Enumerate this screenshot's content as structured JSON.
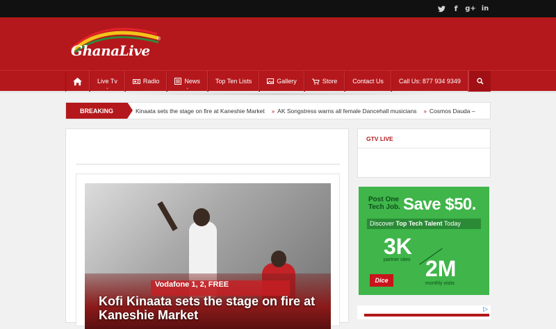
{
  "topbar": {
    "social": [
      {
        "icon": "twitter-icon",
        "glyph": "🐦"
      },
      {
        "icon": "facebook-icon",
        "glyph": "f"
      },
      {
        "icon": "google-plus-icon",
        "glyph": "g+"
      },
      {
        "icon": "linkedin-icon",
        "glyph": "in"
      }
    ]
  },
  "header": {
    "logo_text": "GhanaLive",
    "logo_reg": "®"
  },
  "nav": {
    "items": [
      {
        "label": "Live Tv",
        "has_caret": true
      },
      {
        "label": "Radio",
        "icon": "radio-icon"
      },
      {
        "label": "News",
        "icon": "newspaper-icon",
        "has_caret": true
      },
      {
        "label": "Top Ten Lists"
      },
      {
        "label": "Gallery",
        "icon": "image-icon"
      },
      {
        "label": "Store",
        "icon": "cart-icon"
      },
      {
        "label": "Contact Us"
      },
      {
        "label": "Call Us: 877 934 9349"
      }
    ],
    "home_icon": "home-icon",
    "search_icon": "search-icon"
  },
  "breaking": {
    "label": "BREAKING",
    "items": [
      "Kinaata sets the stage on fire at Kaneshie Market",
      "AK Songstress warns all female Dancehall musicians",
      "Cosmos Dauda –"
    ]
  },
  "feature": {
    "caption": "Kofi Kinaata sets the stage on fire at Kaneshie Market",
    "banner_text": "Vodafone 1, 2, FREE"
  },
  "sidebar": {
    "title": "GTV LIVE"
  },
  "ad": {
    "line1": "Post One\nTech Job.",
    "save": "Save $50.",
    "bar_prefix": "Discover ",
    "bar_bold": "Top Tech Talent",
    "bar_suffix": " Today",
    "num1": "3K",
    "num1_sub": "partner sites",
    "num2": "2M",
    "num2_sub": "monthly visits",
    "brand": "Dice",
    "adchoice_icon": "adchoices-icon"
  },
  "colors": {
    "brand_red": "#b4181c",
    "topbar": "#111111",
    "ad_green": "#3fb54a"
  }
}
